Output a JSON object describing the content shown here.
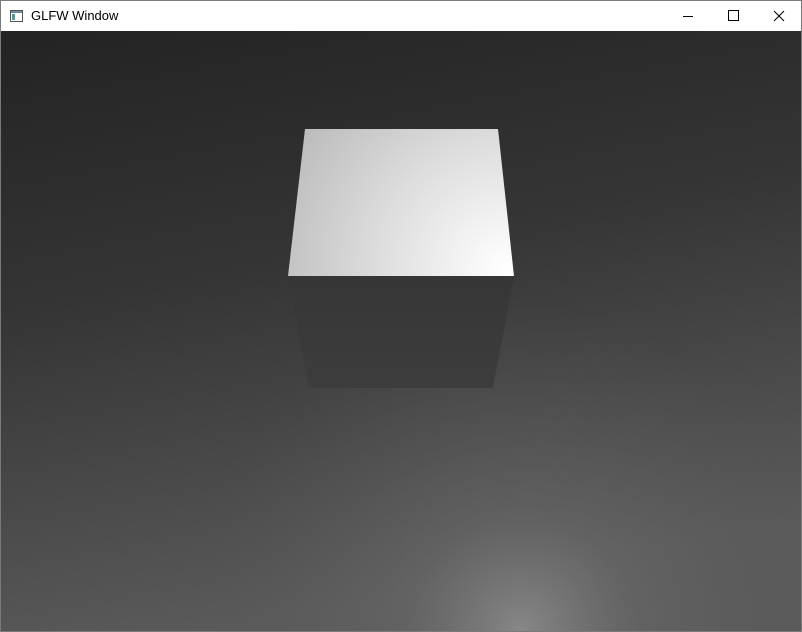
{
  "window": {
    "title": "GLFW Window",
    "icon": "app-window-icon",
    "controls": {
      "minimize_icon": "minimize-icon",
      "maximize_icon": "maximize-icon",
      "close_icon": "close-icon"
    }
  },
  "scene": {
    "background_top_color": "#232323",
    "background_bottom_color": "#5a5a5a",
    "light_spot_color": "#8a8a8a",
    "cube_top_face_light": "#ffffff",
    "cube_top_face_dark": "#bdbdbd",
    "cube_front_face_color": "#3d3d3d"
  }
}
